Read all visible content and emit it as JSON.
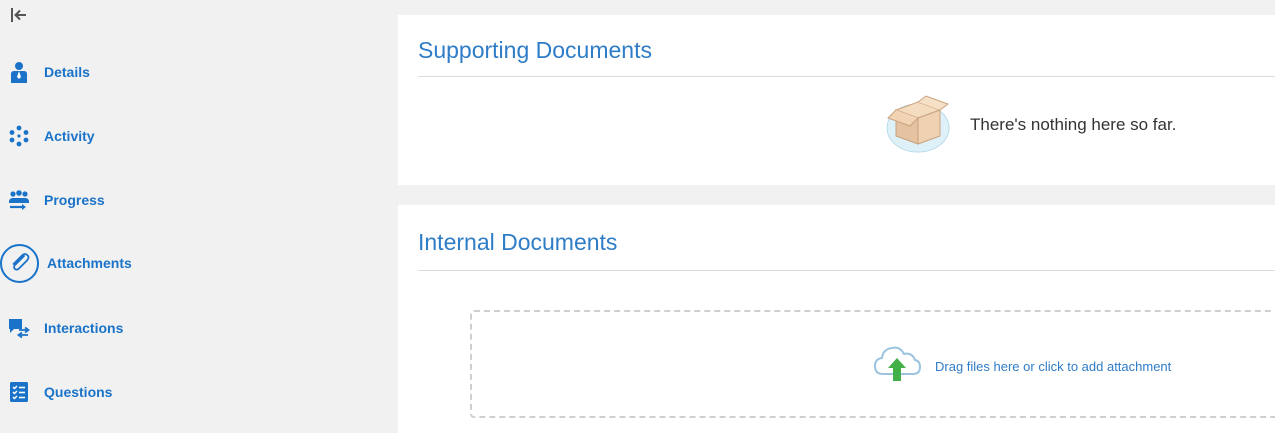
{
  "sidebar": {
    "collapse_icon": "collapse-left-icon",
    "items": [
      {
        "label": "Details",
        "icon": "person-icon"
      },
      {
        "label": "Activity",
        "icon": "activity-circle-icon"
      },
      {
        "label": "Progress",
        "icon": "team-progress-icon"
      },
      {
        "label": "Attachments",
        "icon": "paperclip-icon"
      },
      {
        "label": "Interactions",
        "icon": "chat-exchange-icon"
      },
      {
        "label": "Questions",
        "icon": "checklist-icon"
      }
    ],
    "active": "Attachments"
  },
  "supporting": {
    "title": "Supporting Documents",
    "empty_text": "There's nothing here so far.",
    "empty_icon": "empty-box-icon"
  },
  "internal": {
    "title": "Internal Documents",
    "drop_text": "Drag files here or click to add attachment",
    "drop_icon": "cloud-upload-icon"
  },
  "colors": {
    "accent": "#1a73c9",
    "title": "#2f7cc7",
    "background": "#f1f1f1",
    "panel": "#ffffff"
  }
}
